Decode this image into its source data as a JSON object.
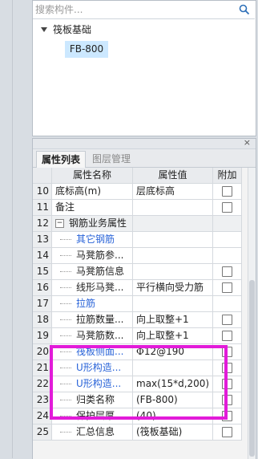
{
  "search": {
    "placeholder": "搜索构件..."
  },
  "tree": {
    "root_label": "筏板基础",
    "child_label": "FB-800"
  },
  "tabs": [
    {
      "label": "属性列表"
    },
    {
      "label": "图层管理"
    }
  ],
  "close_glyph": "×",
  "table": {
    "headers": {
      "name": "属性名称",
      "value": "属性值",
      "attach": "附加"
    },
    "rows": [
      {
        "num": "10",
        "name": "底标高(m)",
        "value": "层底标高"
      },
      {
        "num": "11",
        "name": "备注",
        "value": ""
      },
      {
        "num": "12",
        "expander": "−",
        "name": "钢筋业务属性",
        "value": ""
      },
      {
        "num": "13",
        "name": "其它钢筋",
        "value": ""
      },
      {
        "num": "14",
        "name": "马凳筋参...",
        "value": ""
      },
      {
        "num": "15",
        "name": "马凳筋信息",
        "value": ""
      },
      {
        "num": "16",
        "name": "线形马凳...",
        "value": "平行横向受力筋"
      },
      {
        "num": "17",
        "name": "拉筋",
        "value": ""
      },
      {
        "num": "18",
        "name": "拉筋数量...",
        "value": "向上取整+1"
      },
      {
        "num": "19",
        "name": "马凳筋数...",
        "value": "向上取整+1"
      },
      {
        "num": "20",
        "name": "筏板侧面...",
        "value": "12@190",
        "value_prefix": "Φ"
      },
      {
        "num": "21",
        "name": "U形构造...",
        "value": ""
      },
      {
        "num": "22",
        "name": "U形构造...",
        "value": "max(15*d,200)"
      },
      {
        "num": "23",
        "name": "归类名称",
        "value": "(FB-800)"
      },
      {
        "num": "24",
        "name": "保护层厚...",
        "value": "(40)"
      },
      {
        "num": "25",
        "name": "汇总信息",
        "value": "(筏板基础)"
      }
    ]
  },
  "colors": {
    "highlight": "#e21bd9",
    "link_blue": "#2a64d8",
    "selection": "#cce8ff"
  }
}
